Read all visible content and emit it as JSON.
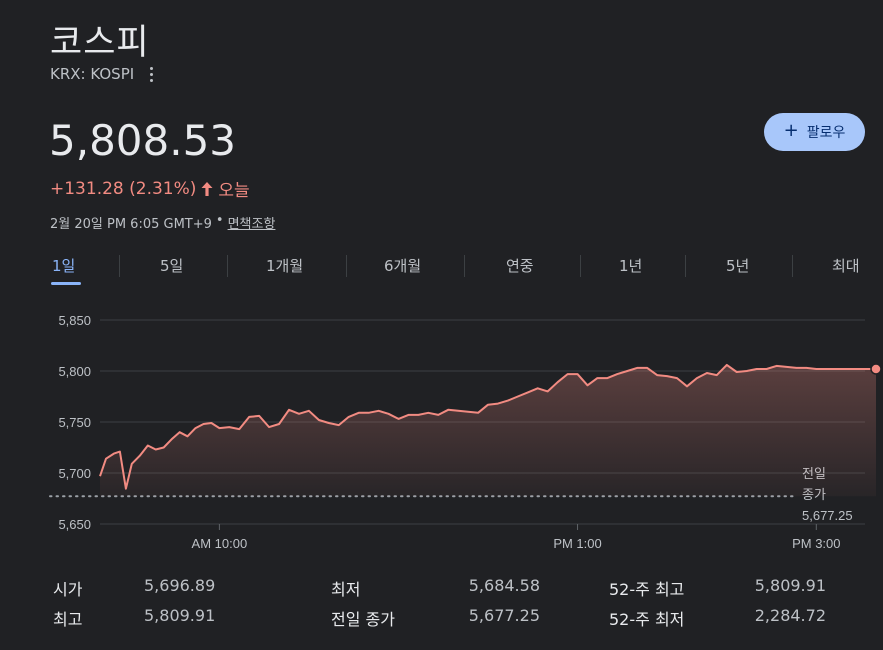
{
  "header": {
    "title": "코스피",
    "ticker": "KRX: KOSPI",
    "price": "5,808.53",
    "change": "+131.28 (2.31%)",
    "change_period": "오늘",
    "timestamp": "2월 20일 PM 6:05 GMT+9",
    "separator": "•",
    "disclaimer_link": "면책조항",
    "follow_label": "팔로우",
    "follow_plus": "+"
  },
  "tabs": [
    "1일",
    "5일",
    "1개월",
    "6개월",
    "연중",
    "1년",
    "5년",
    "최대"
  ],
  "active_tab": 0,
  "colors": {
    "accent": "#8ab4f8",
    "up": "#f28b82",
    "button_bg": "#a8c7fa",
    "background": "#202124"
  },
  "chart_data": {
    "type": "line",
    "y_ticks": [
      "5,850",
      "5,800",
      "5,750",
      "5,700",
      "5,650"
    ],
    "y_tick_values": [
      5850,
      5800,
      5750,
      5700,
      5650
    ],
    "ylim": [
      5650,
      5850
    ],
    "x_ticks": [
      "AM 10:00",
      "PM 1:00",
      "PM 3:00"
    ],
    "x_tick_times": [
      "10:00",
      "13:00",
      "15:00"
    ],
    "x_range": [
      "09:00",
      "15:30"
    ],
    "previous_close": 5677.25,
    "previous_close_label_line1": "전일",
    "previous_close_label_line2": "종가",
    "previous_close_label_value": "5,677.25",
    "series": [
      {
        "times": [
          "09:00",
          "09:03",
          "09:07",
          "09:10",
          "09:13",
          "09:16",
          "09:20",
          "09:24",
          "09:28",
          "09:32",
          "09:36",
          "09:40",
          "09:44",
          "09:48",
          "09:52",
          "09:56",
          "10:00",
          "10:05",
          "10:10",
          "10:15",
          "10:20",
          "10:25",
          "10:30",
          "10:35",
          "10:40",
          "10:45",
          "10:50",
          "10:55",
          "11:00",
          "11:05",
          "11:10",
          "11:15",
          "11:20",
          "11:25",
          "11:30",
          "11:35",
          "11:40",
          "11:45",
          "11:50",
          "11:55",
          "12:00",
          "12:05",
          "12:10",
          "12:15",
          "12:20",
          "12:25",
          "12:30",
          "12:35",
          "12:40",
          "12:45",
          "12:50",
          "12:55",
          "13:00",
          "13:05",
          "13:10",
          "13:15",
          "13:20",
          "13:25",
          "13:30",
          "13:35",
          "13:40",
          "13:45",
          "13:50",
          "13:55",
          "14:00",
          "14:05",
          "14:10",
          "14:15",
          "14:20",
          "14:25",
          "14:30",
          "14:35",
          "14:40",
          "14:45",
          "14:50",
          "14:55",
          "15:00",
          "15:05",
          "15:10",
          "15:15",
          "15:20",
          "15:25",
          "15:30"
        ],
        "values": [
          5696.9,
          5714,
          5719,
          5721,
          5684.6,
          5709,
          5717,
          5727,
          5723,
          5725,
          5733,
          5740,
          5736,
          5744,
          5748,
          5749,
          5744,
          5745,
          5743,
          5755,
          5756,
          5745,
          5748,
          5762,
          5758,
          5761,
          5752,
          5749,
          5747,
          5755,
          5759,
          5759,
          5761,
          5758,
          5753,
          5757,
          5757,
          5759,
          5757,
          5762,
          5761,
          5760,
          5759,
          5767,
          5768,
          5771,
          5775,
          5779,
          5783,
          5780,
          5789,
          5797,
          5797,
          5786,
          5793,
          5793,
          5797,
          5800,
          5803,
          5803,
          5796,
          5795,
          5793,
          5785,
          5793,
          5798,
          5796,
          5806,
          5799,
          5800,
          5802,
          5802,
          5805,
          5804,
          5803,
          5803,
          5802,
          5802,
          5802,
          5802,
          5802,
          5802,
          5802
        ]
      }
    ]
  },
  "stats": [
    [
      {
        "label": "시가",
        "value": "5,696.89"
      },
      {
        "label": "최저",
        "value": "5,684.58"
      },
      {
        "label": "52-주 최고",
        "value": "5,809.91"
      }
    ],
    [
      {
        "label": "최고",
        "value": "5,809.91"
      },
      {
        "label": "전일 종가",
        "value": "5,677.25"
      },
      {
        "label": "52-주 최저",
        "value": "2,284.72"
      }
    ]
  ]
}
